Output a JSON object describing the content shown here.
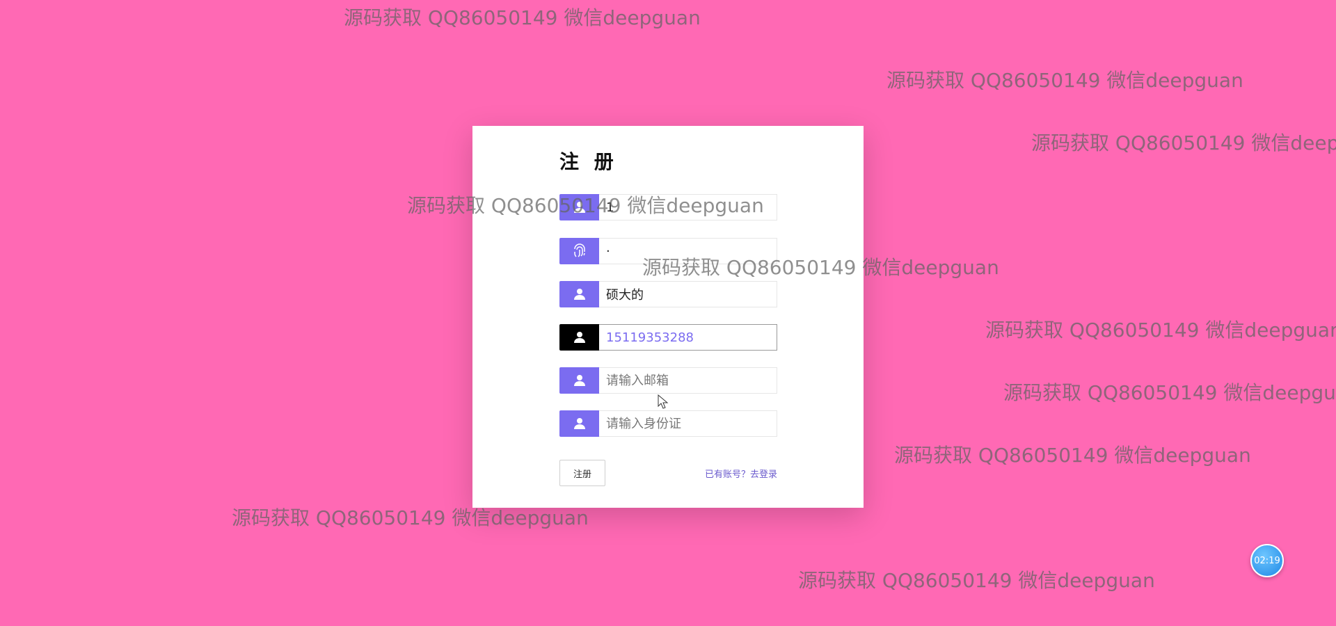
{
  "form": {
    "title": "注 册",
    "fields": [
      {
        "value": "1",
        "placeholder": "",
        "icon": "user-icon"
      },
      {
        "value": "·",
        "placeholder": "",
        "icon": "fingerprint-icon"
      },
      {
        "value": "硕大的",
        "placeholder": "",
        "icon": "user-icon"
      },
      {
        "value": "15119353288",
        "placeholder": "",
        "icon": "user-icon"
      },
      {
        "value": "",
        "placeholder": "请输入邮箱",
        "icon": "user-icon"
      },
      {
        "value": "",
        "placeholder": "请输入身份证",
        "icon": "user-icon"
      }
    ],
    "submit_label": "注册",
    "login_link": "已有账号？去登录"
  },
  "watermark_text": "源码获取 QQ86050149 微信deepguan",
  "timer": "02:19",
  "colors": {
    "background": "#ff69b4",
    "accent": "#7b6cf0",
    "active_icon": "#000000"
  }
}
